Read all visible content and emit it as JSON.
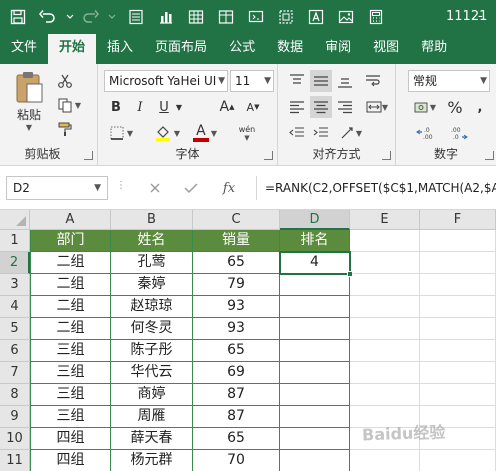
{
  "title_bar": {
    "file_name": "11121",
    "separator": "-",
    "color": "#217346"
  },
  "quick_access": [
    "save-icon",
    "undo-icon",
    "redo-icon",
    "form-icon",
    "chart-icon",
    "table-icon",
    "table2-icon",
    "screen-icon",
    "frame-icon",
    "text-icon",
    "image-icon",
    "calc-icon"
  ],
  "tabs": [
    {
      "label": "文件",
      "active": false
    },
    {
      "label": "开始",
      "active": true
    },
    {
      "label": "插入",
      "active": false
    },
    {
      "label": "页面布局",
      "active": false
    },
    {
      "label": "公式",
      "active": false
    },
    {
      "label": "数据",
      "active": false
    },
    {
      "label": "审阅",
      "active": false
    },
    {
      "label": "视图",
      "active": false
    },
    {
      "label": "帮助",
      "active": false
    }
  ],
  "ribbon": {
    "clipboard": {
      "paste_label": "粘贴",
      "group_label": "剪贴板"
    },
    "font": {
      "font_name": "Microsoft YaHei UI",
      "font_size": "11",
      "bold": "B",
      "italic": "I",
      "underline": "U",
      "grow": "A",
      "shrink": "A",
      "font_color_letter": "A",
      "wen": "wén",
      "group_label": "字体",
      "font_color": "#c00000",
      "fill_color": "#ffff00"
    },
    "alignment": {
      "group_label": "对齐方式"
    },
    "number": {
      "format": "常规",
      "percent": "%",
      "group_label": "数字"
    }
  },
  "formula_bar": {
    "name_box": "D2",
    "fx": "fx",
    "formula": "=RANK(C2,OFFSET($C$1,MATCH(A2,$A"
  },
  "columns": [
    "A",
    "B",
    "C",
    "D",
    "E",
    "F"
  ],
  "rows": [
    "1",
    "2",
    "3",
    "4",
    "5",
    "6",
    "7",
    "8",
    "9",
    "10",
    "11"
  ],
  "headers": [
    "部门",
    "姓名",
    "销量",
    "排名"
  ],
  "data": [
    [
      "二组",
      "孔莺",
      "65",
      "4"
    ],
    [
      "二组",
      "秦婷",
      "79",
      ""
    ],
    [
      "二组",
      "赵琼琼",
      "93",
      ""
    ],
    [
      "二组",
      "何冬灵",
      "93",
      ""
    ],
    [
      "三组",
      "陈子彤",
      "65",
      ""
    ],
    [
      "三组",
      "华代云",
      "69",
      ""
    ],
    [
      "三组",
      "商婷",
      "87",
      ""
    ],
    [
      "三组",
      "周雁",
      "87",
      ""
    ],
    [
      "四组",
      "薛天春",
      "65",
      ""
    ],
    [
      "四组",
      "杨元群",
      "70",
      ""
    ]
  ],
  "selected_cell": "D2",
  "header_fill": "#5b8b3c",
  "watermark": "Baidu经验"
}
